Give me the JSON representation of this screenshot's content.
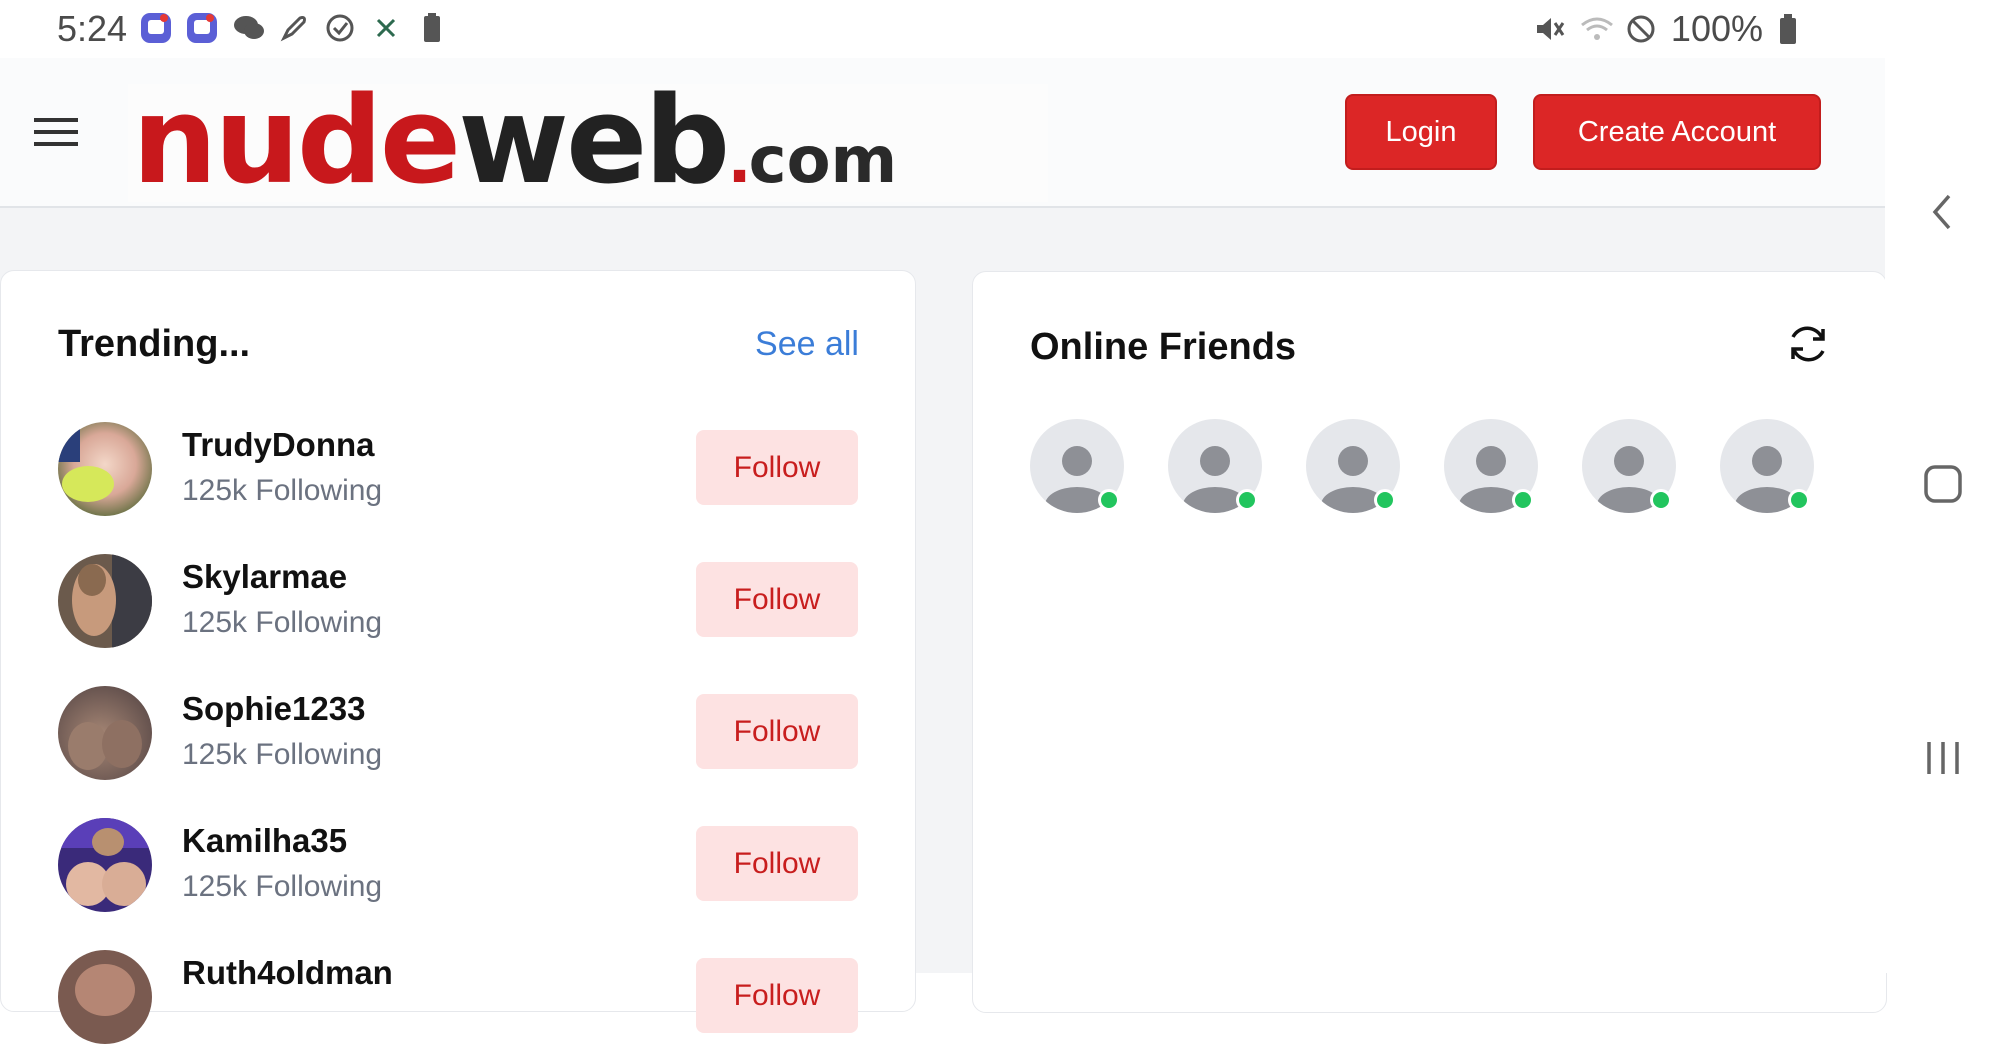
{
  "status_bar": {
    "time": "5:24",
    "battery_percent": "100%",
    "left_icons": [
      "message-app-icon",
      "message-app-icon",
      "chat-icon",
      "rocket-icon",
      "check-circle-icon",
      "signal-x-icon",
      "battery-saver-icon"
    ],
    "right_icons": [
      "mute-icon",
      "wifi-icon",
      "do-not-disturb-icon",
      "battery-icon"
    ]
  },
  "header": {
    "logo": {
      "part1": "nude",
      "part2": "web",
      "dot": ".",
      "part3": "com"
    },
    "login_label": "Login",
    "create_account_label": "Create Account"
  },
  "trending": {
    "title": "Trending...",
    "see_all": "See all",
    "items": [
      {
        "name": "TrudyDonna",
        "sub": "125k Following",
        "follow": "Follow"
      },
      {
        "name": "Skylarmae",
        "sub": "125k Following",
        "follow": "Follow"
      },
      {
        "name": "Sophie1233",
        "sub": "125k Following",
        "follow": "Follow"
      },
      {
        "name": "Kamilha35",
        "sub": "125k Following",
        "follow": "Follow"
      },
      {
        "name": "Ruth4oldman",
        "sub": "",
        "follow": "Follow"
      }
    ]
  },
  "online_friends": {
    "title": "Online Friends",
    "count_visible": 6
  },
  "colors": {
    "brand_red": "#dc2626",
    "follow_bg": "#fde2e2",
    "link_blue": "#3b7dd8",
    "online_green": "#22c55e"
  }
}
